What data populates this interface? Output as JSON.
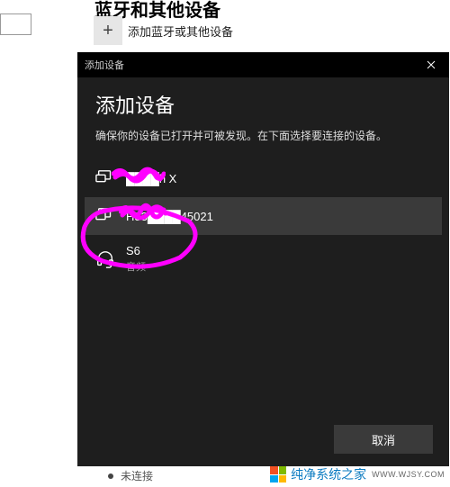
{
  "background": {
    "header_partial": "蓝牙和其他设备",
    "add_button": {
      "icon": "+",
      "label": "添加蓝牙或其他设备"
    }
  },
  "dialog": {
    "titlebar": "添加设备",
    "heading": "添加设备",
    "subtitle": "确保你的设备已打开并可被发现。在下面选择要连接的设备。",
    "devices": [
      {
        "name": "████h X",
        "sub": "",
        "icon": "display"
      },
      {
        "name": "H83████45021",
        "sub": "",
        "icon": "display"
      },
      {
        "name": "S6",
        "sub": "音频",
        "icon": "headset"
      }
    ],
    "cancel": "取消"
  },
  "footer": {
    "status": "未连接"
  },
  "watermark": {
    "text": "纯净系统之家",
    "url": "WWW.WJSY.COM"
  }
}
